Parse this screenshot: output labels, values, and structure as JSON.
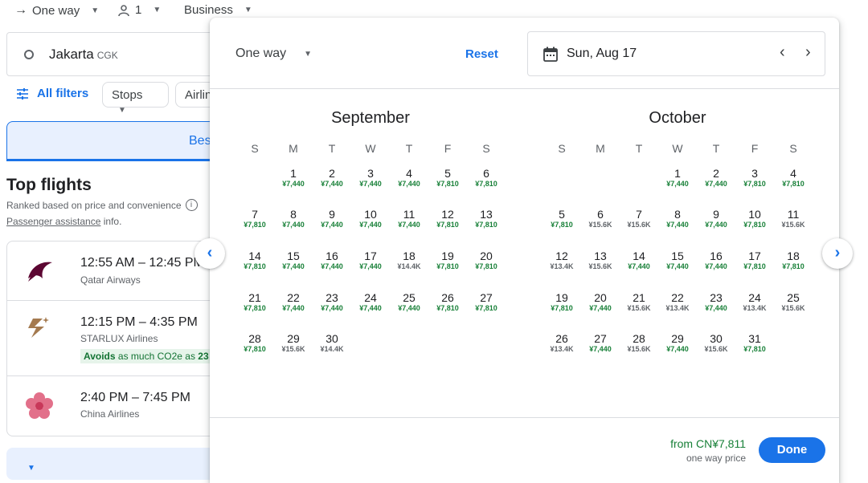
{
  "search_bar": {
    "trip_type": "One way",
    "passengers": "1",
    "cabin": "Business"
  },
  "origin": {
    "city": "Jakarta",
    "code": "CGK"
  },
  "filters": {
    "all_filters": "All filters",
    "chip1": "Stops",
    "chip2": "Airlin"
  },
  "sort_tab": {
    "label": "Bes"
  },
  "results": {
    "title": "Top flights",
    "ranked": "Ranked based on price and convenience",
    "assistance_link": "Passenger assistance",
    "assistance_suffix": " info."
  },
  "flights": [
    {
      "time": "12:55 AM – 12:45 PM",
      "airline": "Qatar Airways",
      "logo": "qatar-logo"
    },
    {
      "time": "12:15 PM – 4:35 PM",
      "airline": "STARLUX Airlines",
      "co2_label": "Avoids",
      "co2_text": " as much CO2e as ",
      "co2_value": "23",
      "logo": "starlux-logo"
    },
    {
      "time": "2:40 PM – 7:45 PM",
      "airline": "China Airlines",
      "logo": "china-airlines-logo"
    }
  ],
  "datepicker": {
    "trip_type": "One way",
    "reset": "Reset",
    "selected_date": "Sun, Aug 17",
    "weekdays": [
      "S",
      "M",
      "T",
      "W",
      "T",
      "F",
      "S"
    ],
    "months": [
      {
        "name": "September",
        "first_weekday": 1,
        "days": [
          [
            "1",
            "¥7,440"
          ],
          [
            "2",
            "¥7,440"
          ],
          [
            "3",
            "¥7,440"
          ],
          [
            "4",
            "¥7,440"
          ],
          [
            "5",
            "¥7,810"
          ],
          [
            "6",
            "¥7,810"
          ],
          [
            "7",
            "¥7,810"
          ],
          [
            "8",
            "¥7,440"
          ],
          [
            "9",
            "¥7,440"
          ],
          [
            "10",
            "¥7,440"
          ],
          [
            "11",
            "¥7,440"
          ],
          [
            "12",
            "¥7,810"
          ],
          [
            "13",
            "¥7,810"
          ],
          [
            "14",
            "¥7,810"
          ],
          [
            "15",
            "¥7,440"
          ],
          [
            "16",
            "¥7,440"
          ],
          [
            "17",
            "¥7,440"
          ],
          [
            "18",
            "¥14.4K"
          ],
          [
            "19",
            "¥7,810"
          ],
          [
            "20",
            "¥7,810"
          ],
          [
            "21",
            "¥7,810"
          ],
          [
            "22",
            "¥7,440"
          ],
          [
            "23",
            "¥7,440"
          ],
          [
            "24",
            "¥7,440"
          ],
          [
            "25",
            "¥7,440"
          ],
          [
            "26",
            "¥7,810"
          ],
          [
            "27",
            "¥7,810"
          ],
          [
            "28",
            "¥7,810"
          ],
          [
            "29",
            "¥15.6K"
          ],
          [
            "30",
            "¥14.4K"
          ]
        ]
      },
      {
        "name": "October",
        "first_weekday": 3,
        "days": [
          [
            "1",
            "¥7,440"
          ],
          [
            "2",
            "¥7,440"
          ],
          [
            "3",
            "¥7,810"
          ],
          [
            "4",
            "¥7,810"
          ],
          [
            "5",
            "¥7,810"
          ],
          [
            "6",
            "¥15.6K"
          ],
          [
            "7",
            "¥15.6K"
          ],
          [
            "8",
            "¥7,440"
          ],
          [
            "9",
            "¥7,440"
          ],
          [
            "10",
            "¥7,810"
          ],
          [
            "11",
            "¥15.6K"
          ],
          [
            "12",
            "¥13.4K"
          ],
          [
            "13",
            "¥15.6K"
          ],
          [
            "14",
            "¥7,440"
          ],
          [
            "15",
            "¥7,440"
          ],
          [
            "16",
            "¥7,440"
          ],
          [
            "17",
            "¥7,810"
          ],
          [
            "18",
            "¥7,810"
          ],
          [
            "19",
            "¥7,810"
          ],
          [
            "20",
            "¥7,440"
          ],
          [
            "21",
            "¥15.6K"
          ],
          [
            "22",
            "¥13.4K"
          ],
          [
            "23",
            "¥7,440"
          ],
          [
            "24",
            "¥13.4K"
          ],
          [
            "25",
            "¥15.6K"
          ],
          [
            "26",
            "¥13.4K"
          ],
          [
            "27",
            "¥7,440"
          ],
          [
            "28",
            "¥15.6K"
          ],
          [
            "29",
            "¥7,440"
          ],
          [
            "30",
            "¥15.6K"
          ],
          [
            "31",
            "¥7,810"
          ]
        ]
      }
    ],
    "footer": {
      "from_price": "from CN¥7,811",
      "one_way_price": "one way price",
      "done": "Done"
    }
  },
  "colors": {
    "accent": "#1a73e8",
    "low_price": "#188038",
    "high_price": "#5f6368"
  }
}
